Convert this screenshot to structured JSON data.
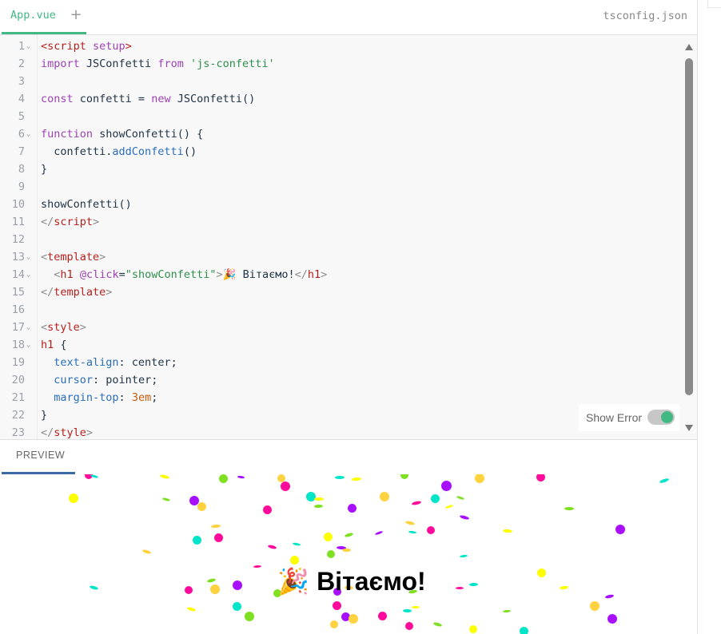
{
  "tabs": {
    "active": "App.vue",
    "add_symbol": "+",
    "right_file": "tsconfig.json"
  },
  "editor": {
    "language": "vue",
    "lines": [
      {
        "n": "1",
        "fold": true,
        "tokens": [
          [
            "tag",
            "<script"
          ],
          [
            "plain",
            " "
          ],
          [
            "attr",
            "setup"
          ],
          [
            "tag",
            ">"
          ]
        ]
      },
      {
        "n": "2",
        "fold": false,
        "tokens": [
          [
            "kw",
            "import"
          ],
          [
            "plain",
            " JSConfetti "
          ],
          [
            "kw",
            "from"
          ],
          [
            "plain",
            " "
          ],
          [
            "str",
            "'js-confetti'"
          ]
        ]
      },
      {
        "n": "3",
        "fold": false,
        "tokens": []
      },
      {
        "n": "4",
        "fold": false,
        "tokens": [
          [
            "kw",
            "const"
          ],
          [
            "plain",
            " confetti = "
          ],
          [
            "kw",
            "new"
          ],
          [
            "plain",
            " JSConfetti()"
          ]
        ]
      },
      {
        "n": "5",
        "fold": false,
        "tokens": []
      },
      {
        "n": "6",
        "fold": true,
        "tokens": [
          [
            "kw",
            "function"
          ],
          [
            "plain",
            " showConfetti() {"
          ]
        ]
      },
      {
        "n": "7",
        "fold": false,
        "tokens": [
          [
            "plain",
            "  confetti."
          ],
          [
            "fn",
            "addConfetti"
          ],
          [
            "plain",
            "()"
          ]
        ]
      },
      {
        "n": "8",
        "fold": false,
        "tokens": [
          [
            "plain",
            "}"
          ]
        ]
      },
      {
        "n": "9",
        "fold": false,
        "tokens": []
      },
      {
        "n": "10",
        "fold": false,
        "tokens": [
          [
            "plain",
            "showConfetti()"
          ]
        ]
      },
      {
        "n": "11",
        "fold": false,
        "tokens": [
          [
            "punc",
            "</"
          ],
          [
            "tag",
            "script"
          ],
          [
            "punc",
            ">"
          ]
        ]
      },
      {
        "n": "12",
        "fold": false,
        "tokens": []
      },
      {
        "n": "13",
        "fold": true,
        "tokens": [
          [
            "punc",
            "<"
          ],
          [
            "tag",
            "template"
          ],
          [
            "punc",
            ">"
          ]
        ]
      },
      {
        "n": "14",
        "fold": true,
        "tokens": [
          [
            "plain",
            "  "
          ],
          [
            "punc",
            "<"
          ],
          [
            "tag",
            "h1"
          ],
          [
            "plain",
            " "
          ],
          [
            "attr",
            "@click"
          ],
          [
            "plain",
            "="
          ],
          [
            "str",
            "\"showConfetti\""
          ],
          [
            "punc",
            ">"
          ],
          [
            "plain",
            "🎉 Вітаємо!"
          ],
          [
            "punc",
            "</"
          ],
          [
            "tag",
            "h1"
          ],
          [
            "punc",
            ">"
          ]
        ]
      },
      {
        "n": "15",
        "fold": false,
        "tokens": [
          [
            "punc",
            "</"
          ],
          [
            "tag",
            "template"
          ],
          [
            "punc",
            ">"
          ]
        ]
      },
      {
        "n": "16",
        "fold": false,
        "tokens": []
      },
      {
        "n": "17",
        "fold": true,
        "tokens": [
          [
            "punc",
            "<"
          ],
          [
            "tag",
            "style"
          ],
          [
            "punc",
            ">"
          ]
        ]
      },
      {
        "n": "18",
        "fold": true,
        "tokens": [
          [
            "tag",
            "h1"
          ],
          [
            "plain",
            " {"
          ]
        ]
      },
      {
        "n": "19",
        "fold": false,
        "tokens": [
          [
            "plain",
            "  "
          ],
          [
            "prop",
            "text-align"
          ],
          [
            "plain",
            ": center;"
          ]
        ]
      },
      {
        "n": "20",
        "fold": false,
        "tokens": [
          [
            "plain",
            "  "
          ],
          [
            "prop",
            "cursor"
          ],
          [
            "plain",
            ": pointer;"
          ]
        ]
      },
      {
        "n": "21",
        "fold": false,
        "tokens": [
          [
            "plain",
            "  "
          ],
          [
            "prop",
            "margin-top"
          ],
          [
            "plain",
            ": "
          ],
          [
            "num",
            "3em"
          ],
          [
            "plain",
            ";"
          ]
        ]
      },
      {
        "n": "22",
        "fold": false,
        "tokens": [
          [
            "plain",
            "}"
          ]
        ]
      },
      {
        "n": "23",
        "fold": false,
        "tokens": [
          [
            "punc",
            "</"
          ],
          [
            "tag",
            "style"
          ],
          [
            "punc",
            ">"
          ]
        ]
      }
    ]
  },
  "toggle": {
    "label": "Show Error",
    "on": true
  },
  "preview": {
    "tab_label": "PREVIEW",
    "heading": "🎉 Вітаємо!"
  },
  "colors": {
    "accent": "#42b883",
    "preview_accent": "#3c6aa5",
    "confetti": [
      "#ff0a9b",
      "#00e5c8",
      "#fdff00",
      "#7ee021",
      "#a90fff",
      "#ffd23f"
    ]
  }
}
